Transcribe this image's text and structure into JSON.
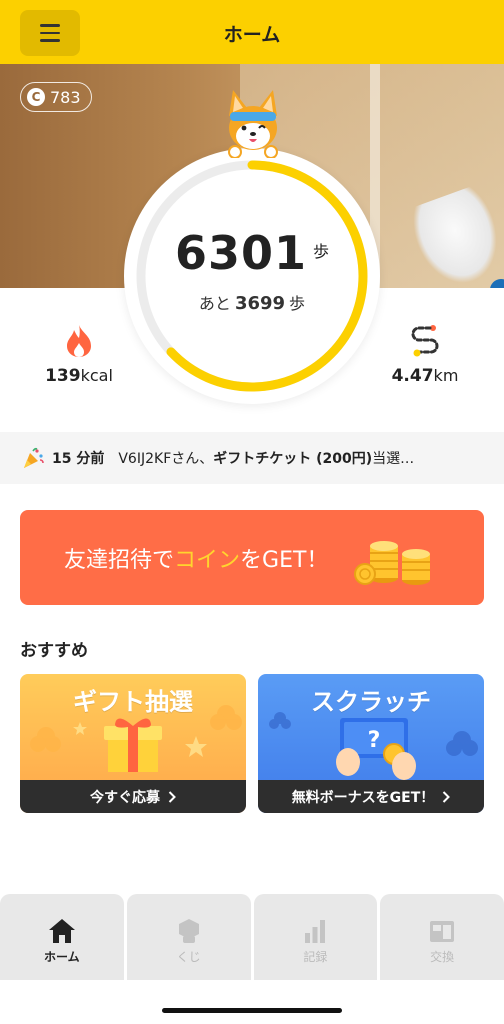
{
  "header": {
    "title": "ホーム",
    "menu_icon": "hamburger-icon"
  },
  "coin_badge": {
    "icon": "coin-icon",
    "icon_letter": "C",
    "value": "783"
  },
  "steps": {
    "count": "6301",
    "unit": "歩",
    "remaining_prefix": "あと",
    "remaining": "3699",
    "remaining_unit": "歩",
    "progress": 0.63
  },
  "stats": {
    "calories": {
      "value": "139",
      "unit": "kcal",
      "icon": "flame-icon"
    },
    "distance": {
      "value": "4.47",
      "unit": "km",
      "icon": "route-icon"
    }
  },
  "ticker": {
    "icon": "party-popper-icon",
    "time": "15 分前",
    "user": "V6IJ2KFさん、",
    "prize": "ギフトチケット (200円)",
    "suffix": "当選…"
  },
  "invite": {
    "part1": "友達招待で",
    "highlight": "コイン",
    "part2": "をGET！"
  },
  "recommend": {
    "title": "おすすめ",
    "cards": [
      {
        "title": "ギフト抽選",
        "cta": "今すぐ応募",
        "cta_icon": "chevron-right-icon"
      },
      {
        "title": "スクラッチ",
        "cta": "無料ボーナスをGET！",
        "cta_icon": "chevron-right-icon"
      }
    ]
  },
  "tabs": [
    {
      "label": "ホーム",
      "icon": "home-icon",
      "active": true
    },
    {
      "label": "くじ",
      "icon": "lottery-icon",
      "active": false
    },
    {
      "label": "記録",
      "icon": "bar-chart-icon",
      "active": false
    },
    {
      "label": "交換",
      "icon": "exchange-icon",
      "active": false
    }
  ],
  "colors": {
    "accent": "#fcd000",
    "invite_bg": "#ff6d47",
    "ring": "#fcd000"
  }
}
